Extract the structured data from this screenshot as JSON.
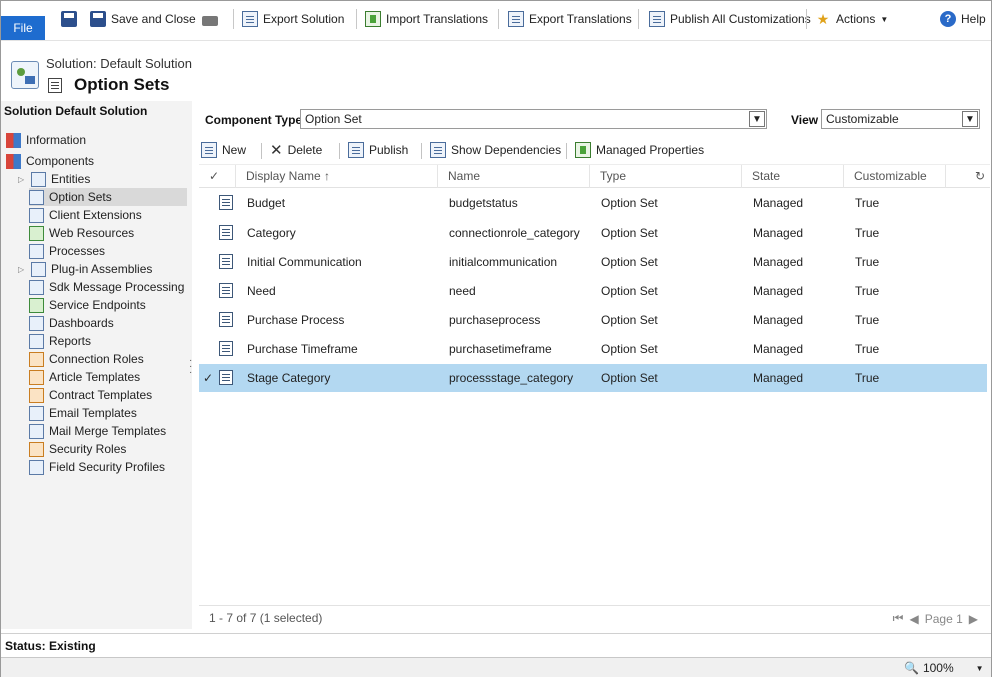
{
  "ribbon": {
    "file": "File",
    "save_and_close": "Save and Close",
    "export_solution": "Export Solution",
    "import_translations": "Import Translations",
    "export_translations": "Export Translations",
    "publish_all": "Publish All Customizations",
    "actions": "Actions",
    "help": "Help"
  },
  "header": {
    "solution": "Solution: Default Solution",
    "title": "Option Sets"
  },
  "sidebar": {
    "title": "Solution Default Solution",
    "items": [
      {
        "label": "Information"
      },
      {
        "label": "Components"
      },
      {
        "label": "Entities"
      },
      {
        "label": "Option Sets"
      },
      {
        "label": "Client Extensions"
      },
      {
        "label": "Web Resources"
      },
      {
        "label": "Processes"
      },
      {
        "label": "Plug-in Assemblies"
      },
      {
        "label": "Sdk Message Processing S..."
      },
      {
        "label": "Service Endpoints"
      },
      {
        "label": "Dashboards"
      },
      {
        "label": "Reports"
      },
      {
        "label": "Connection Roles"
      },
      {
        "label": "Article Templates"
      },
      {
        "label": "Contract Templates"
      },
      {
        "label": "Email Templates"
      },
      {
        "label": "Mail Merge Templates"
      },
      {
        "label": "Security Roles"
      },
      {
        "label": "Field Security Profiles"
      }
    ]
  },
  "filters": {
    "component_type_label": "Component Type",
    "component_type_value": "Option Set",
    "view_label": "View",
    "view_value": "Customizable"
  },
  "toolbar": {
    "new": "New",
    "delete": "Delete",
    "publish": "Publish",
    "show_dependencies": "Show Dependencies",
    "managed_properties": "Managed Properties"
  },
  "grid": {
    "columns": [
      "Display Name ↑",
      "Name",
      "Type",
      "State",
      "Customizable"
    ],
    "rows": [
      {
        "display": "Budget",
        "name": "budgetstatus",
        "type": "Option Set",
        "state": "Managed",
        "custom": "True"
      },
      {
        "display": "Category",
        "name": "connectionrole_category",
        "type": "Option Set",
        "state": "Managed",
        "custom": "True"
      },
      {
        "display": "Initial Communication",
        "name": "initialcommunication",
        "type": "Option Set",
        "state": "Managed",
        "custom": "True"
      },
      {
        "display": "Need",
        "name": "need",
        "type": "Option Set",
        "state": "Managed",
        "custom": "True"
      },
      {
        "display": "Purchase Process",
        "name": "purchaseprocess",
        "type": "Option Set",
        "state": "Managed",
        "custom": "True"
      },
      {
        "display": "Purchase Timeframe",
        "name": "purchasetimeframe",
        "type": "Option Set",
        "state": "Managed",
        "custom": "True"
      },
      {
        "display": "Stage Category",
        "name": "processstage_category",
        "type": "Option Set",
        "state": "Managed",
        "custom": "True"
      }
    ],
    "footer_count": "1 - 7 of 7 (1 selected)",
    "page": "Page 1"
  },
  "status": "Status: Existing",
  "zoom": "100%"
}
